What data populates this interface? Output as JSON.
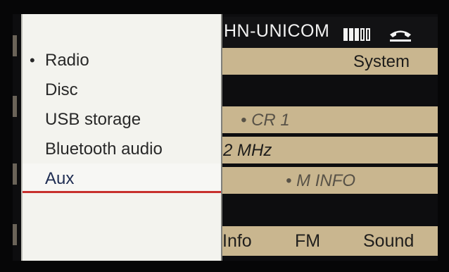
{
  "status_bar": {
    "operator_text": "HN-UNICOM",
    "signal_bars_filled": 3,
    "signal_bars_total": 5,
    "phone_icon": "phone-handset-icon"
  },
  "right_screen": {
    "system_label": "System",
    "station_label": "• CR 1",
    "frequency_text": "2 MHz",
    "info_label": "• M INFO",
    "softkeys": [
      "Info",
      "FM",
      "Sound"
    ]
  },
  "menu": {
    "items": [
      {
        "label": "Radio",
        "bullet": "•"
      },
      {
        "label": "Disc",
        "bullet": ""
      },
      {
        "label": "USB storage",
        "bullet": ""
      },
      {
        "label": "Bluetooth audio",
        "bullet": ""
      },
      {
        "label": "Aux",
        "bullet": ""
      }
    ],
    "selected_index": 4,
    "accent_color": "#c7302d"
  }
}
